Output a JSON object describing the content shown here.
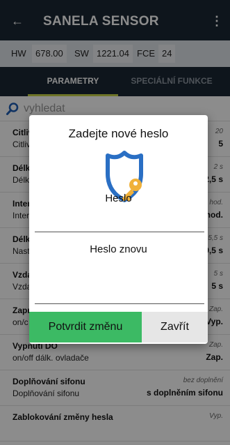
{
  "appbar": {
    "back_icon": "arrow-left-icon",
    "title": "SANELA SENSOR",
    "menu_icon": "more-vert-icon"
  },
  "hw": {
    "hw_label": "HW",
    "hw_value": "678.00",
    "sw_label": "SW",
    "sw_value": "1221.04",
    "fce_label": "FCE",
    "fce_value": "24"
  },
  "tabs": [
    {
      "label": "PARAMETRY"
    },
    {
      "label": "SPECIÁLNÍ FUNKCE"
    }
  ],
  "search": {
    "placeholder": "vyhledat"
  },
  "list": [
    {
      "title": "Citliv",
      "subtitle": "Citliv",
      "right_top": "20",
      "right_value": "5"
    },
    {
      "title": "Délk",
      "subtitle": "Délk",
      "right_top": "2 s",
      "right_value": "2,5 s"
    },
    {
      "title": "Inter",
      "subtitle": "Inter",
      "right_top": "hod.",
      "right_value": "hod."
    },
    {
      "title": "Délk",
      "subtitle": "Nast",
      "right_top": "5,5 s",
      "right_value": "9,5 s"
    },
    {
      "title": "Vzda",
      "subtitle": "Vzda",
      "right_top": "5 s",
      "right_value": "5 s"
    },
    {
      "title": "Zapr",
      "subtitle": "on/c",
      "right_top": "Zap.",
      "right_value": "Vyp."
    },
    {
      "title": "Vypnutí DO",
      "subtitle": "on/off dálk. ovladače",
      "right_top": "Zap.",
      "right_value": "Zap."
    },
    {
      "title": "Doplňování sifonu",
      "subtitle": "Doplňování sifonu",
      "right_top": "bez doplnění",
      "right_value": "s doplněním sifonu"
    },
    {
      "title": "Zablokování změny hesla",
      "subtitle": "",
      "right_top": "Vyp.",
      "right_value": ""
    }
  ],
  "dialog": {
    "title": "Zadejte nové heslo",
    "icon": "shield-key-icon",
    "password_label": "Heslo",
    "password_value": "",
    "password_again_label": "Heslo znovu",
    "password_again_value": "",
    "confirm_label": "Potvrdit změnu",
    "close_label": "Zavřít"
  },
  "colors": {
    "appbar": "#1b2733",
    "tab_underline": "#c8d44a",
    "confirm": "#3cba64",
    "shield": "#2a6fc4",
    "key": "#f0b13a"
  }
}
